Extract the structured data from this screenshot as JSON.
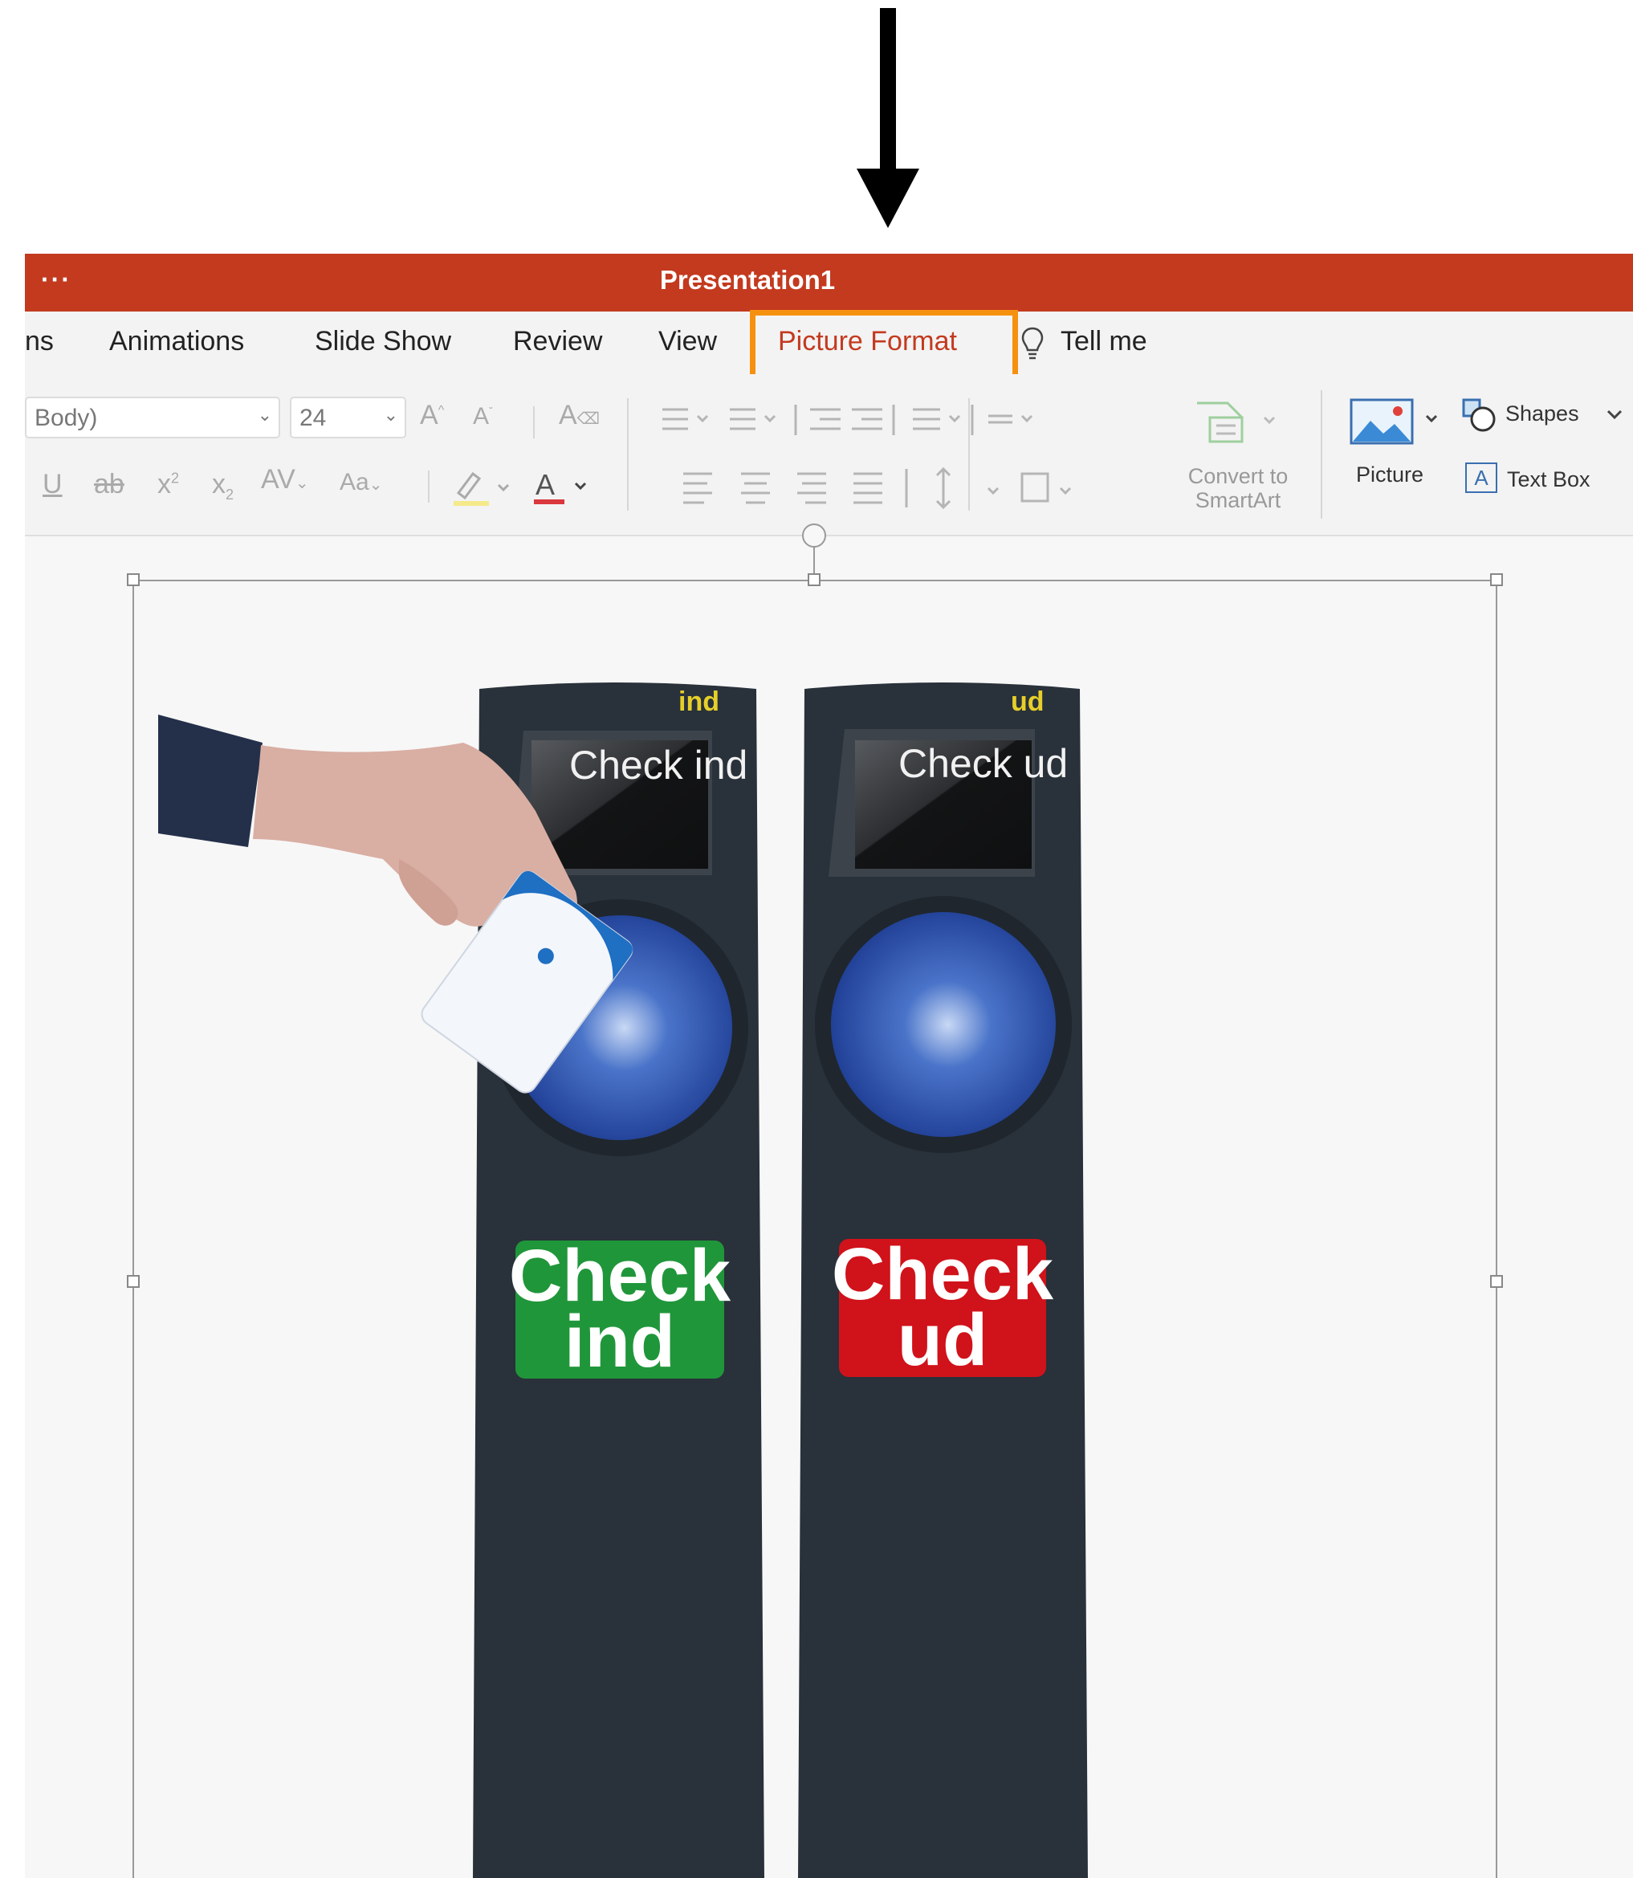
{
  "window": {
    "title": "Presentation1",
    "menu_dots": "···"
  },
  "tabs": [
    {
      "label": "ns"
    },
    {
      "label": "Animations"
    },
    {
      "label": "Slide Show"
    },
    {
      "label": "Review"
    },
    {
      "label": "View"
    },
    {
      "label": "Picture Format",
      "highlighted": true
    },
    {
      "label": "Tell me"
    }
  ],
  "ribbon": {
    "font_name": "Body)",
    "font_size": "24",
    "convert_smartart_line1": "Convert to",
    "convert_smartart_line2": "SmartArt",
    "picture_label": "Picture",
    "shapes_label": "Shapes",
    "textbox_label": "Text Box",
    "textbox_icon_letter": "A"
  },
  "slide": {
    "left_device": {
      "top_label": "ind",
      "screen_text": "Check ind",
      "button_line1": "Check",
      "button_line2": "ind",
      "button_color": "#20963a"
    },
    "right_device": {
      "top_label": "ud",
      "screen_text": "Check ud",
      "button_line1": "Check",
      "button_line2": "ud",
      "button_color": "#d0121a"
    }
  },
  "colors": {
    "titlebar": "#c33a1f",
    "highlight": "#f5910f",
    "accent_tab": "#c33a1f"
  }
}
